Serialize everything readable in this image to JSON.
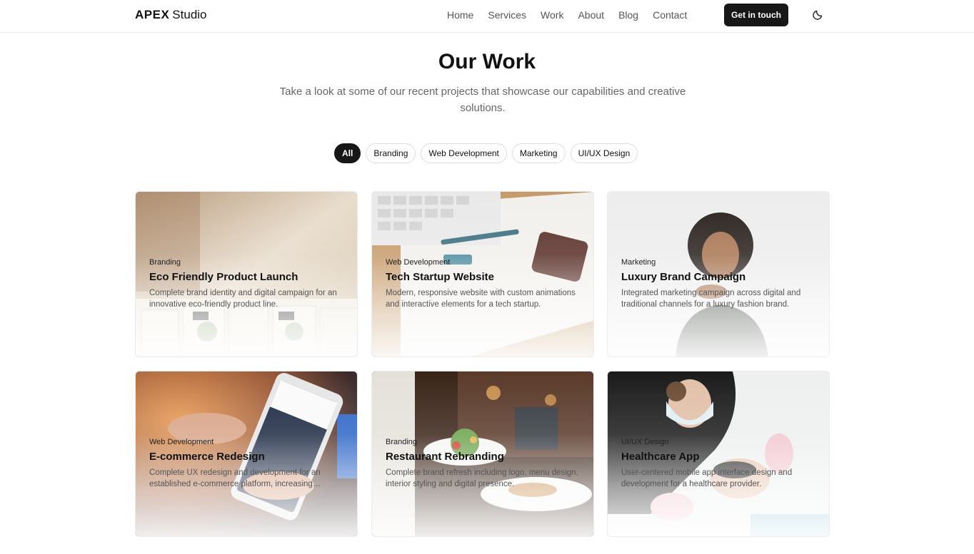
{
  "header": {
    "brand_bold": "APEX",
    "brand_light": "Studio",
    "nav": [
      "Home",
      "Services",
      "Work",
      "About",
      "Blog",
      "Contact"
    ],
    "cta_label": "Get in touch",
    "theme_icon": "moon-icon"
  },
  "section": {
    "title": "Our Work",
    "subtitle": "Take a look at some of our recent projects that showcase our capabilities and creative solutions."
  },
  "filters": {
    "selected": "All",
    "items": [
      "All",
      "Branding",
      "Web Development",
      "Marketing",
      "UI/UX Design"
    ]
  },
  "projects": [
    {
      "category": "Branding",
      "title": "Eco Friendly Product Launch",
      "description": "Complete brand identity and digital campaign for an innovative eco-friendly product line."
    },
    {
      "category": "Web Development",
      "title": "Tech Startup Website",
      "description": "Modern, responsive website with custom animations and interactive elements for a tech startup."
    },
    {
      "category": "Marketing",
      "title": "Luxury Brand Campaign",
      "description": "Integrated marketing campaign across digital and traditional channels for a luxury fashion brand."
    },
    {
      "category": "Web Development",
      "title": "E-commerce Redesign",
      "description": "Complete UX redesign and development for an established e-commerce platform, increasing conversions."
    },
    {
      "category": "Branding",
      "title": "Restaurant Rebranding",
      "description": "Complete brand refresh including logo, menu design, interior styling and digital presence."
    },
    {
      "category": "UI/UX Design",
      "title": "Healthcare App",
      "description": "User-centered mobile app interface design and development for a healthcare provider."
    }
  ],
  "colors": {
    "accent": "#171717",
    "text": "#111111",
    "muted": "#666666",
    "border": "#dedede"
  }
}
